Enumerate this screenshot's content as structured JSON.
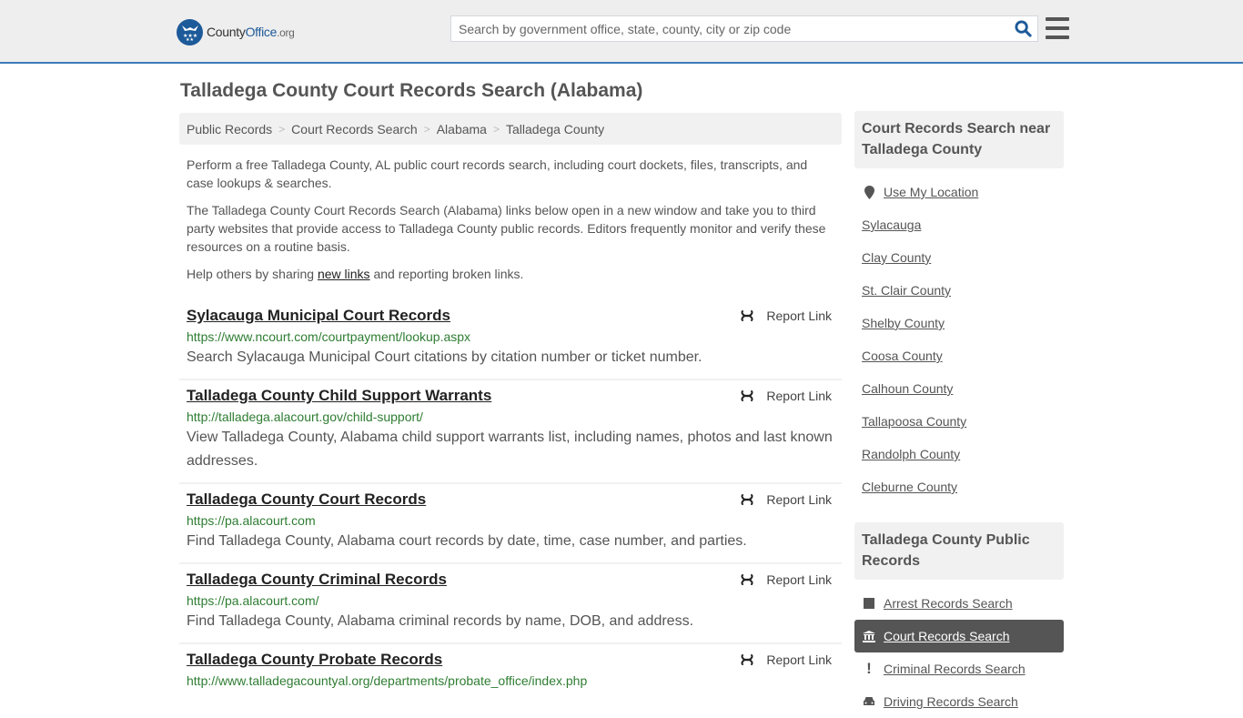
{
  "header": {
    "logo": {
      "brand_a": "County",
      "brand_b": "Office",
      "brand_c": ".org"
    },
    "search": {
      "placeholder": "Search by government office, state, county, city or zip code",
      "value": ""
    },
    "icons": {
      "search": "search-icon",
      "menu": "hamburger-menu-icon",
      "logo": "eagle-stars-logo"
    }
  },
  "page": {
    "title": "Talladega County Court Records Search (Alabama)"
  },
  "breadcrumb": [
    {
      "label": "Public Records"
    },
    {
      "label": "Court Records Search"
    },
    {
      "label": "Alabama"
    },
    {
      "label": "Talladega County"
    }
  ],
  "intro": {
    "p1": "Perform a free Talladega County, AL public court records search, including court dockets, files, transcripts, and case lookups & searches.",
    "p2": "The Talladega County Court Records Search (Alabama) links below open in a new window and take you to third party websites that provide access to Talladega County public records. Editors frequently monitor and verify these resources on a routine basis.",
    "p3_before": "Help others by sharing ",
    "p3_link": "new links",
    "p3_after": " and reporting broken links."
  },
  "results": [
    {
      "title": "Sylacauga Municipal Court Records",
      "url": "https://www.ncourt.com/courtpayment/lookup.aspx",
      "description": "Search Sylacauga Municipal Court citations by citation number or ticket number.",
      "report_label": "Report Link"
    },
    {
      "title": "Talladega County Child Support Warrants",
      "url": "http://talladega.alacourt.gov/child-support/",
      "description": "View Talladega County, Alabama child support warrants list, including names, photos and last known addresses.",
      "report_label": "Report Link"
    },
    {
      "title": "Talladega County Court Records",
      "url": "https://pa.alacourt.com",
      "description": "Find Talladega County, Alabama court records by date, time, case number, and parties.",
      "report_label": "Report Link"
    },
    {
      "title": "Talladega County Criminal Records",
      "url": "https://pa.alacourt.com/",
      "description": "Find Talladega County, Alabama criminal records by name, DOB, and address.",
      "report_label": "Report Link"
    },
    {
      "title": "Talladega County Probate Records",
      "url": "http://www.talladegacountyal.org/departments/probate_office/index.php",
      "description": "",
      "report_label": "Report Link"
    }
  ],
  "sidebar": {
    "nearby": {
      "heading": "Court Records Search near Talladega County",
      "use_location": "Use My Location",
      "items": [
        "Sylacauga",
        "Clay County",
        "St. Clair County",
        "Shelby County",
        "Coosa County",
        "Calhoun County",
        "Tallapoosa County",
        "Randolph County",
        "Cleburne County"
      ]
    },
    "public_records": {
      "heading": "Talladega County Public Records",
      "items": [
        {
          "label": "Arrest Records Search",
          "icon": "square-icon",
          "active": false
        },
        {
          "label": "Court Records Search",
          "icon": "courthouse-icon",
          "active": true
        },
        {
          "label": "Criminal Records Search",
          "icon": "exclamation-icon",
          "active": false
        },
        {
          "label": "Driving Records Search",
          "icon": "car-icon",
          "active": false
        }
      ]
    }
  },
  "colors": {
    "accent_blue": "#3a7ab8",
    "logo_blue": "#1d5a99",
    "url_green": "#2e7d32",
    "active_bg": "#555555"
  }
}
